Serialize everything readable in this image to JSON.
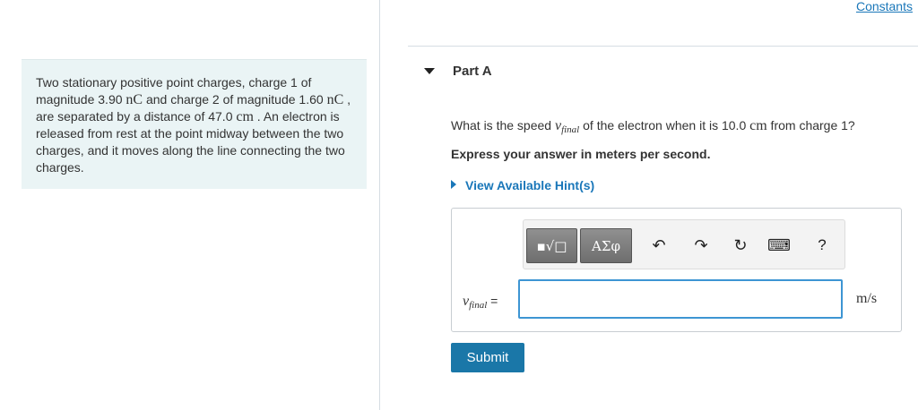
{
  "header": {
    "constants_link": "Constants"
  },
  "problem": {
    "t1": "Two stationary positive point charges, charge 1 of magnitude 3.90 ",
    "unit1": "nC",
    "t2": " and charge 2 of magnitude 1.60 ",
    "unit2": "nC",
    "t3": " , are separated by a distance of 47.0 ",
    "unit3": "cm",
    "t4": " . An electron is released from rest at the point midway between the two charges, and it moves along the line connecting the two charges."
  },
  "part": {
    "title": "Part A"
  },
  "question": {
    "prefix": "What is the speed ",
    "var": "v",
    "var_sub": "final",
    "middle": " of the electron when it is 10.0 ",
    "unit": "cm",
    "suffix": " from charge 1?"
  },
  "instructions": "Express your answer in meters per second.",
  "hints_link": "View Available Hint(s)",
  "toolbar": {
    "templates_label": "▪√□",
    "greek_label": "ΑΣφ",
    "undo_glyph": "↶",
    "redo_glyph": "↷",
    "reset_glyph": "↻",
    "keyboard_glyph": "⌨",
    "help_label": "?"
  },
  "answer": {
    "var": "v",
    "var_sub": "final",
    "equals": " =",
    "value": "",
    "unit": "m/s"
  },
  "submit_label": "Submit",
  "colors": {
    "accent_link": "#1a77b9",
    "submit_bg": "#1a77a8",
    "problem_bg": "#eaf4f5",
    "input_border": "#3d95d3"
  }
}
